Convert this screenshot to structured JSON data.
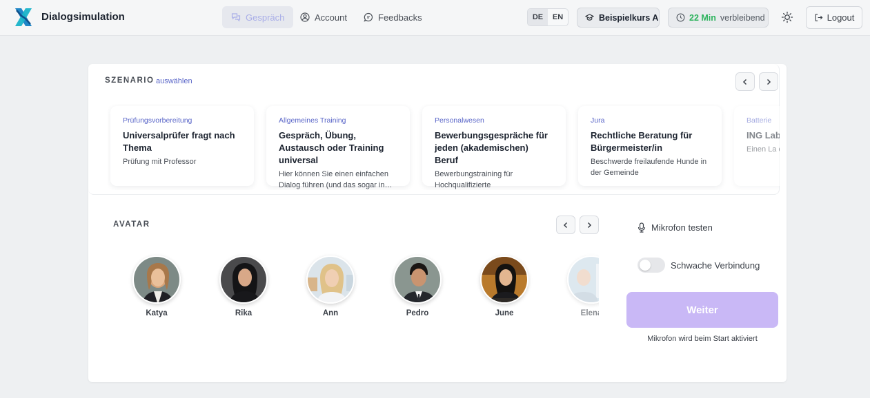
{
  "header": {
    "brand": "Dialogsimulation",
    "nav": [
      {
        "label": "Gespräch",
        "icon": "chat-bubbles-icon",
        "active": true
      },
      {
        "label": "Account",
        "icon": "user-circle-icon",
        "active": false
      },
      {
        "label": "Feedbacks",
        "icon": "feedback-bubble-icon",
        "active": false
      }
    ],
    "languages": [
      "DE",
      "EN"
    ],
    "active_language": "DE",
    "course": "Beispielkurs A",
    "timer_value": "22 Min",
    "timer_suffix": "verbleibend",
    "logout": "Logout"
  },
  "scenario": {
    "label": "SZENARIO",
    "select_link": "auswählen",
    "cards": [
      {
        "category": "Prüfungsvorbereitung",
        "title": "Universalprüfer fragt nach Thema",
        "description": "Prüfung mit Professor"
      },
      {
        "category": "Allgemeines Training",
        "title": "Gespräch, Übung, Austausch oder Training universal",
        "description": "Hier können Sie einen einfachen Dialog führen (und das sogar in…"
      },
      {
        "category": "Personalwesen",
        "title": "Bewerbungsgespräche für jeden (akademischen) Beruf",
        "description": "Bewerbungstraining für Hochqualifizierte"
      },
      {
        "category": "Jura",
        "title": "Rechtliche Beratung für Bürgermeister/in",
        "description": "Beschwerde freilaufende Hunde in der Gemeinde"
      },
      {
        "category": "Batterie",
        "title": "ING Lab Reflekt",
        "description": "Einen La dokume"
      }
    ]
  },
  "avatar": {
    "label": "AVATAR",
    "items": [
      {
        "name": "Katya"
      },
      {
        "name": "Rika"
      },
      {
        "name": "Ann"
      },
      {
        "name": "Pedro"
      },
      {
        "name": "June"
      },
      {
        "name": "Elena"
      }
    ]
  },
  "panel": {
    "mic_test": "Mikrofon testen",
    "weak_connection": "Schwache Verbindung",
    "weak_connection_on": false,
    "next_button": "Weiter",
    "mic_note": "Mikrofon wird beim Start aktiviert"
  },
  "colors": {
    "accent": "#5a66c8",
    "next_button": "#c9b8f6",
    "timer_green": "#2db35d"
  }
}
